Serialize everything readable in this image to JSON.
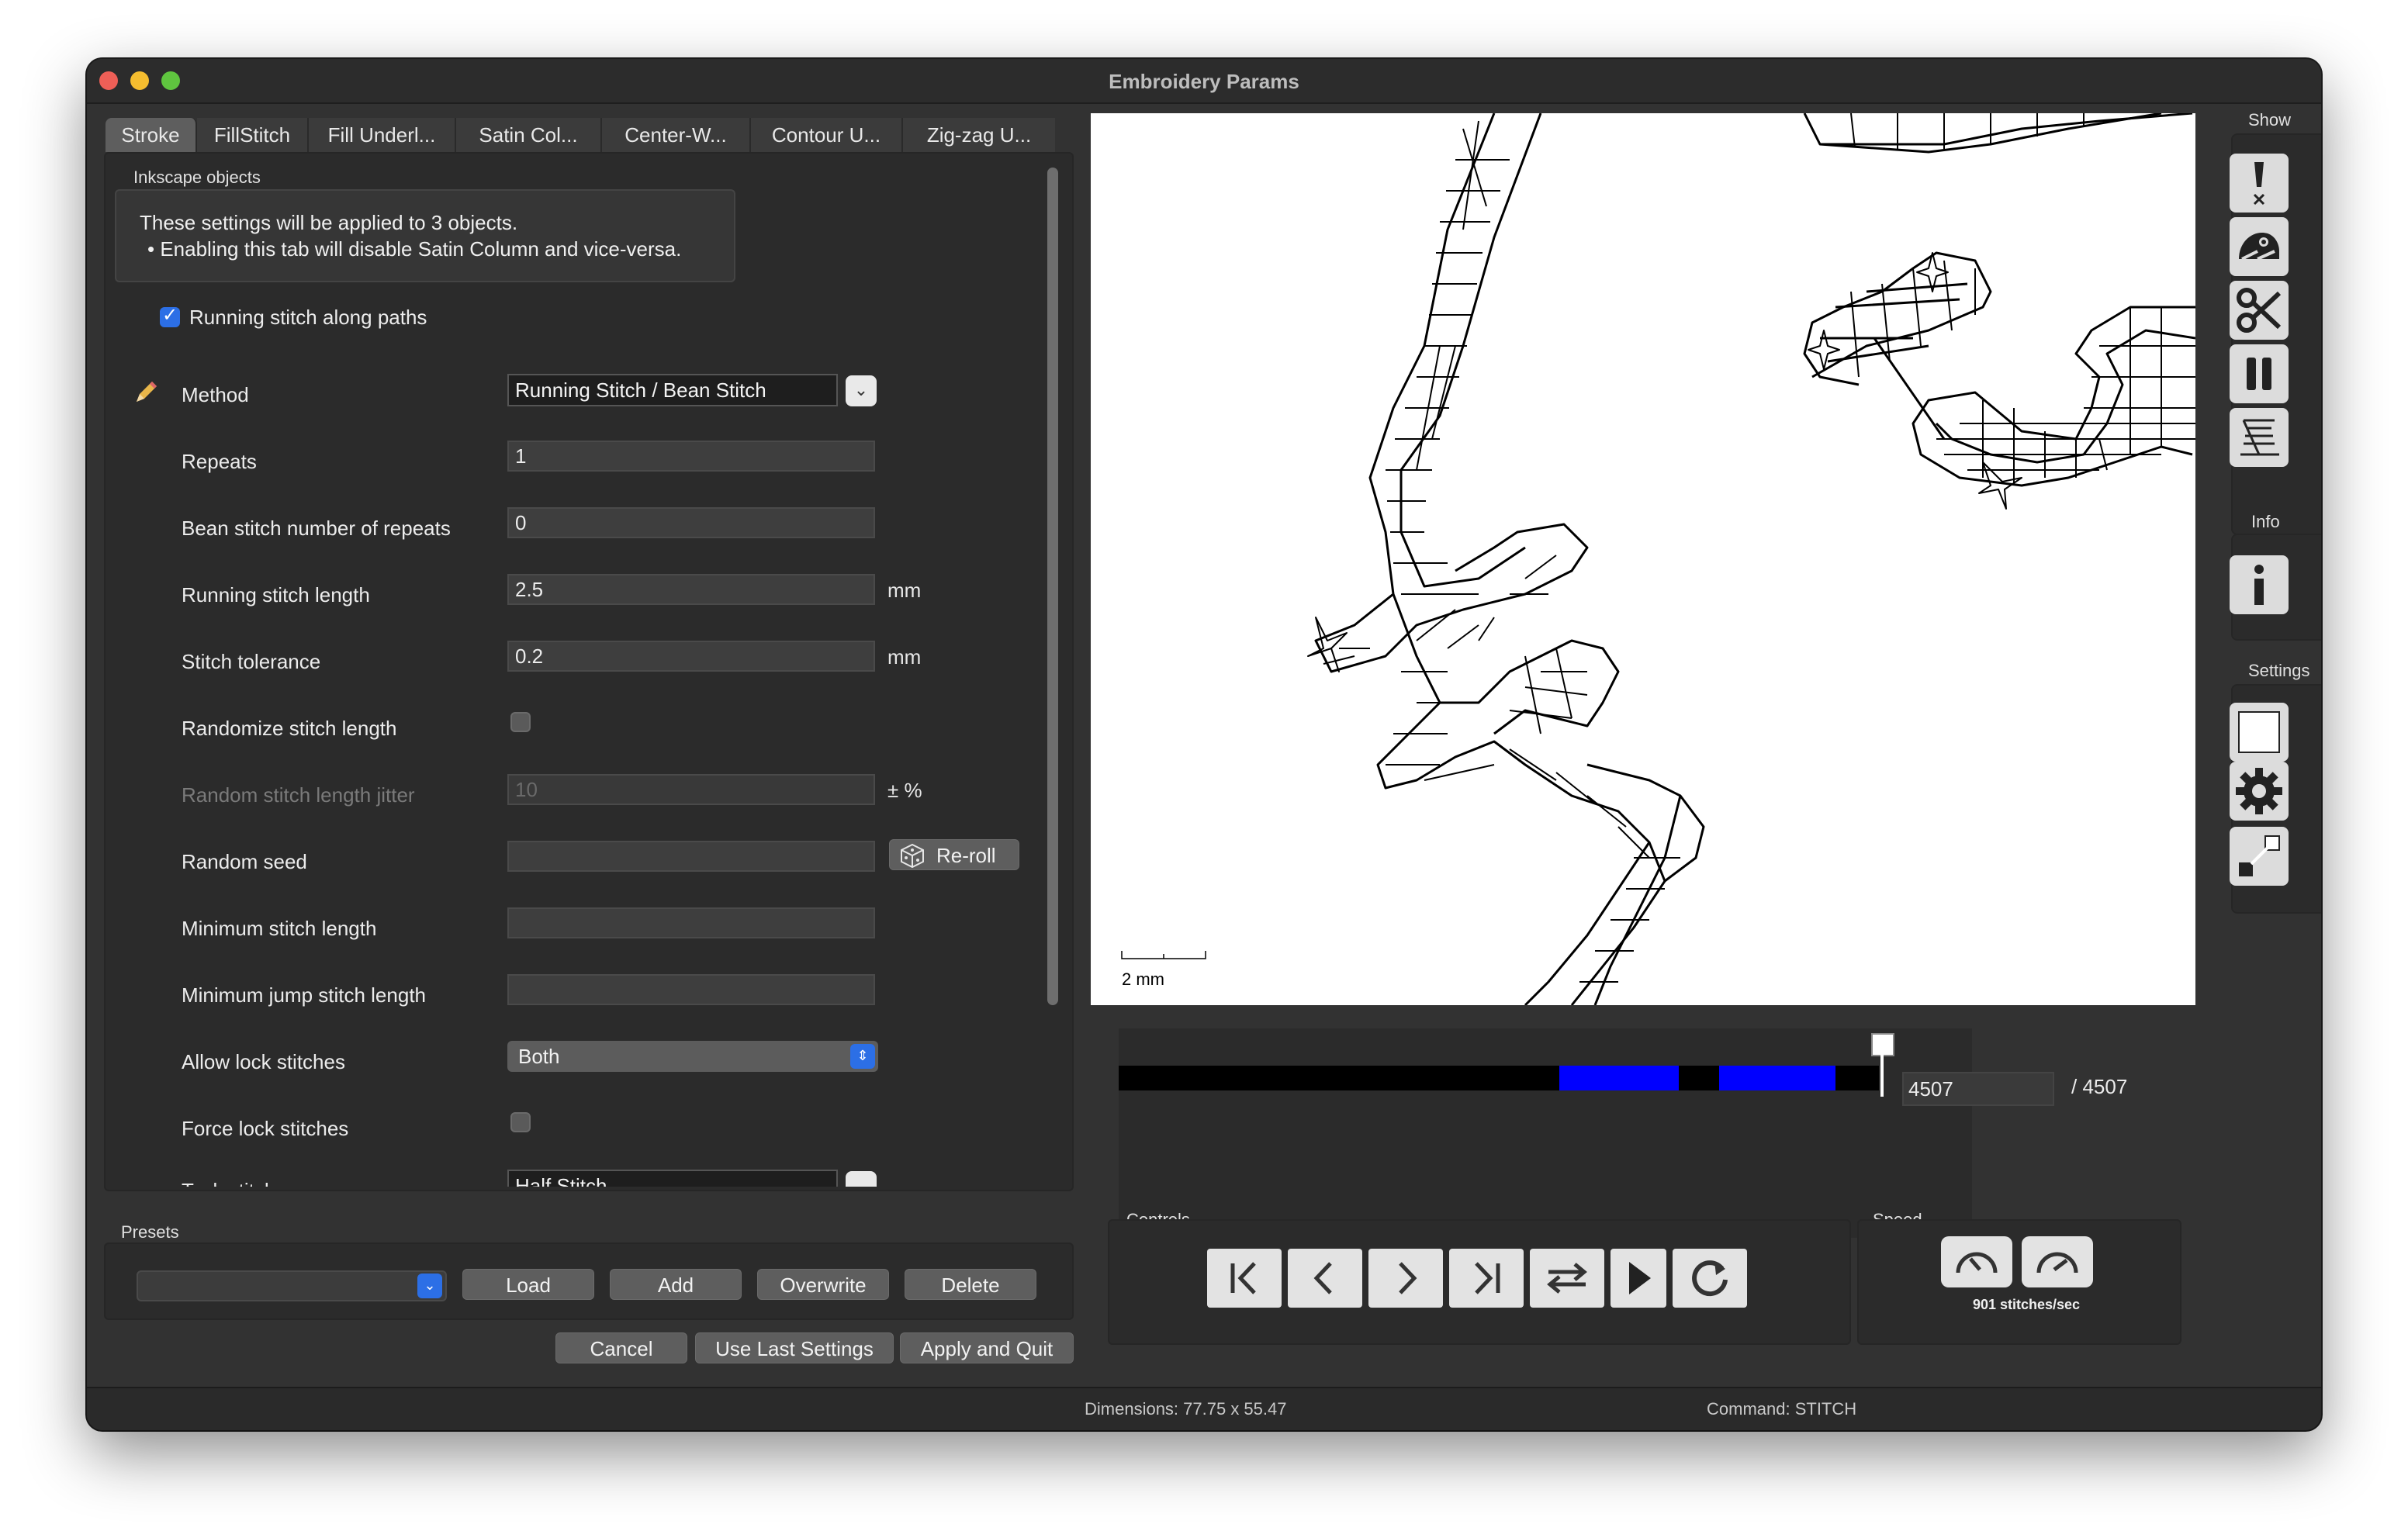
{
  "window": {
    "title": "Embroidery Params"
  },
  "tabs": [
    "Stroke",
    "FillStitch",
    "Fill Underl...",
    "Satin Col...",
    "Center-W...",
    "Contour U...",
    "Zig-zag U..."
  ],
  "group": {
    "title": "Inkscape objects",
    "info_line1": "These settings will be applied to 3 objects.",
    "info_line2": "• Enabling this tab will disable Satin Column and vice-versa."
  },
  "enable_checkbox": {
    "label": "Running stitch along paths",
    "checked": true
  },
  "params": {
    "method": {
      "label": "Method",
      "value": "Running Stitch / Bean Stitch"
    },
    "repeats": {
      "label": "Repeats",
      "value": "1"
    },
    "bean": {
      "label": "Bean stitch number of repeats",
      "value": "0"
    },
    "running_length": {
      "label": "Running stitch length",
      "value": "2.5",
      "unit": "mm"
    },
    "tolerance": {
      "label": "Stitch tolerance",
      "value": "0.2",
      "unit": "mm"
    },
    "randomize": {
      "label": "Randomize stitch length",
      "checked": false
    },
    "jitter": {
      "label": "Random stitch length jitter",
      "value": "10",
      "unit": "± %"
    },
    "seed": {
      "label": "Random seed",
      "value": "",
      "reroll": "Re-roll"
    },
    "min_stitch": {
      "label": "Minimum stitch length",
      "value": ""
    },
    "min_jump": {
      "label": "Minimum jump stitch length",
      "value": ""
    },
    "lock": {
      "label": "Allow lock stitches",
      "value": "Both"
    },
    "force_lock": {
      "label": "Force lock stitches",
      "checked": false
    },
    "tack": {
      "label": "Tack stitch",
      "value": "Half Stitch"
    }
  },
  "presets": {
    "label": "Presets",
    "selected": "",
    "load": "Load",
    "add": "Add",
    "overwrite": "Overwrite",
    "delete": "Delete"
  },
  "footer": {
    "cancel": "Cancel",
    "use_last": "Use Last Settings",
    "apply": "Apply and Quit"
  },
  "preview": {
    "scale_label": "2 mm"
  },
  "sidebar": {
    "show": "Show",
    "info": "Info",
    "settings": "Settings"
  },
  "timeline": {
    "current": "4507",
    "total": "/ 4507",
    "current_fraction": 1.0
  },
  "controls": {
    "label": "Controls"
  },
  "speed": {
    "label": "Speed",
    "value": "901 stitches/sec"
  },
  "status": {
    "dimensions": "Dimensions: 77.75 x 55.47",
    "command": "Command: STITCH"
  },
  "colors": {
    "accent": "#2c6fe6",
    "timeline_color": "#0000ff"
  }
}
